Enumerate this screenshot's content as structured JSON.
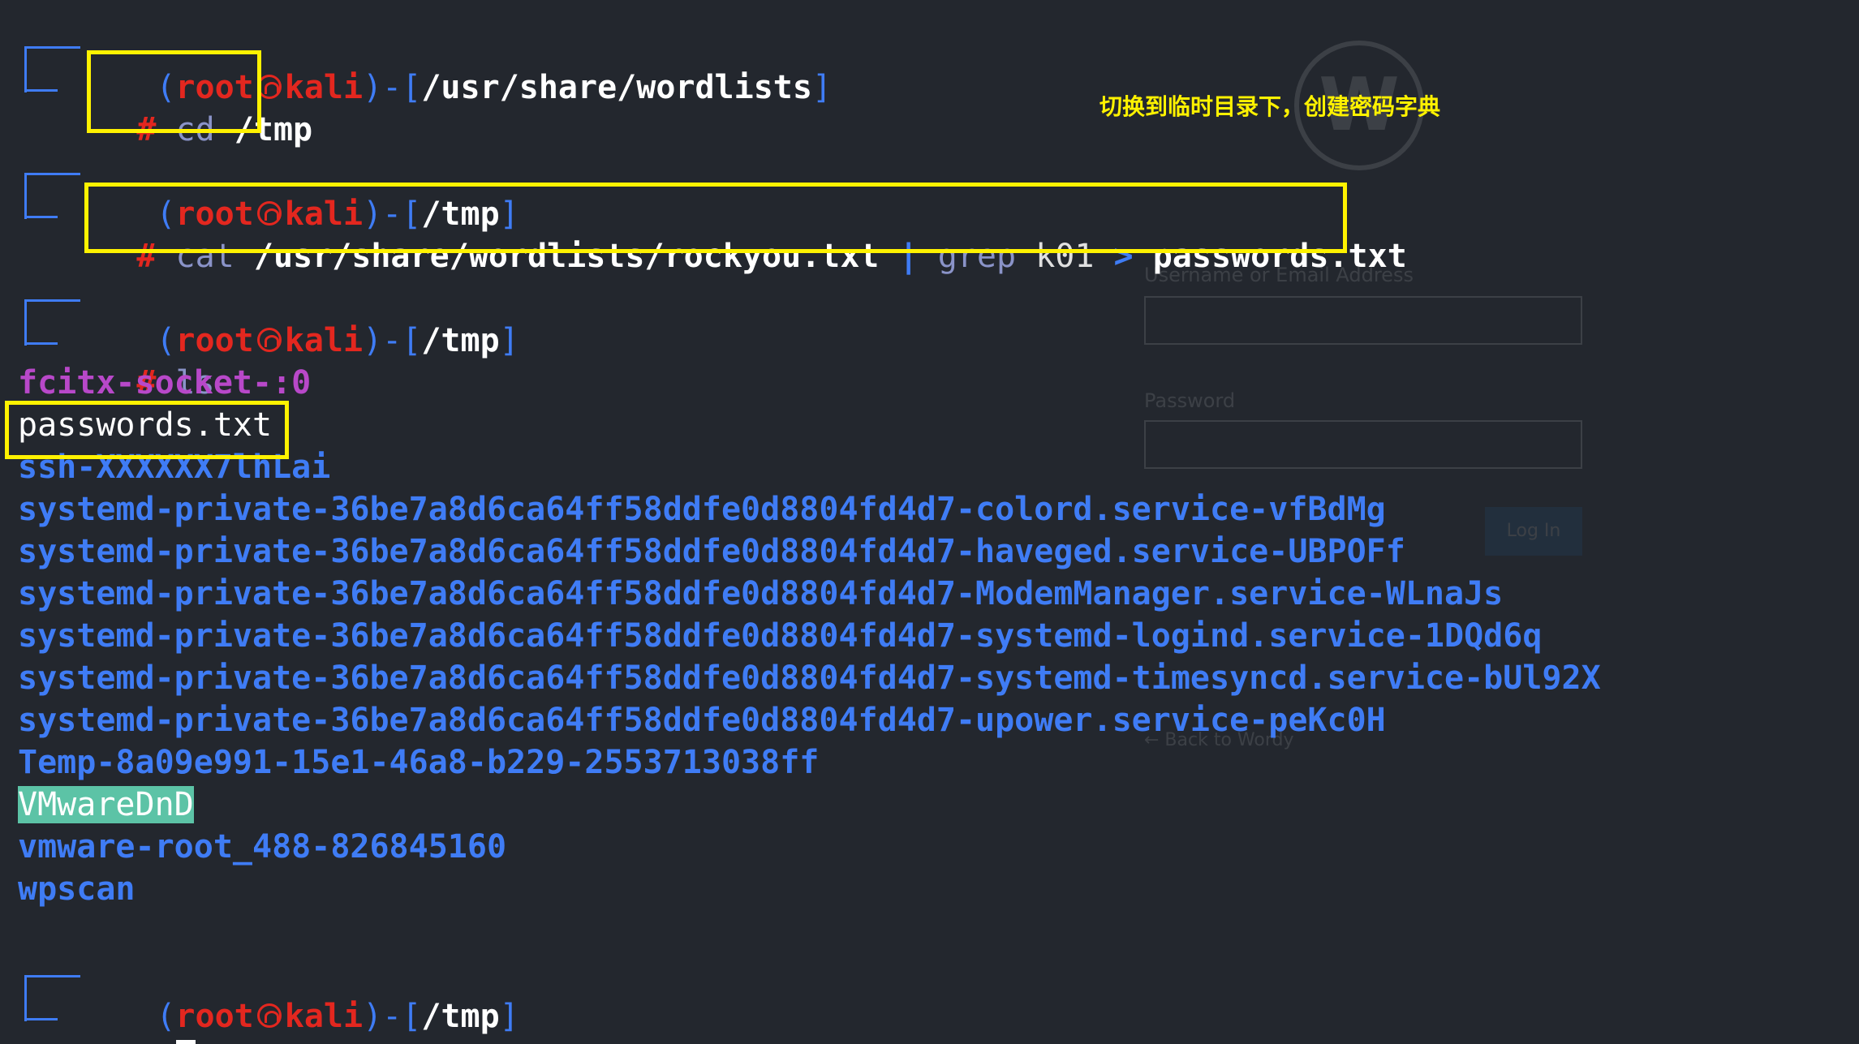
{
  "prompt": {
    "open": "(",
    "user": "root",
    "host": "kali",
    "mid": ")-[",
    "close": "]",
    "hash": "#"
  },
  "blocks": [
    {
      "path": "/usr/share/wordlists",
      "cmd": "cd",
      "args": "/tmp"
    },
    {
      "path": "/tmp",
      "cmd": "cat",
      "arg1": "/usr/share/wordlists/rockyou.txt",
      "pipe": "|",
      "cmd2": "grep",
      "arg2": "k01",
      "redir": ">",
      "arg3": "passwords.txt"
    },
    {
      "path": "/tmp",
      "cmd": "ls"
    },
    {
      "path": "/tmp"
    }
  ],
  "ls_output": [
    "fcitx-socket-:0",
    "passwords.txt",
    "ssh-XXXXXX7lhLai",
    "systemd-private-36be7a8d6ca64ff58ddfe0d8804fd4d7-colord.service-vfBdMg",
    "systemd-private-36be7a8d6ca64ff58ddfe0d8804fd4d7-haveged.service-UBPOFf",
    "systemd-private-36be7a8d6ca64ff58ddfe0d8804fd4d7-ModemManager.service-WLnaJs",
    "systemd-private-36be7a8d6ca64ff58ddfe0d8804fd4d7-systemd-logind.service-1DQd6q",
    "systemd-private-36be7a8d6ca64ff58ddfe0d8804fd4d7-systemd-timesyncd.service-bUl92X",
    "systemd-private-36be7a8d6ca64ff58ddfe0d8804fd4d7-upower.service-peKc0H",
    "Temp-8a09e991-15e1-46a8-b229-2553713038ff",
    "VMwareDnD",
    "vmware-root_488-826845160",
    "wpscan"
  ],
  "annotation": "切换到临时目录下，创建密码字典",
  "ghost": {
    "logo": "W",
    "username_label": "Username or Email Address",
    "password_label": "Password",
    "login_button": "Log In",
    "back_link": "← Back to Wordy"
  },
  "colors": {
    "background": "#23272e",
    "prompt_blue": "#3f7cf5",
    "prompt_red": "#e3271f",
    "highlight_box": "#fff200",
    "dir_listing": "#3f7cf5",
    "socket_purple": "#b848c9"
  }
}
